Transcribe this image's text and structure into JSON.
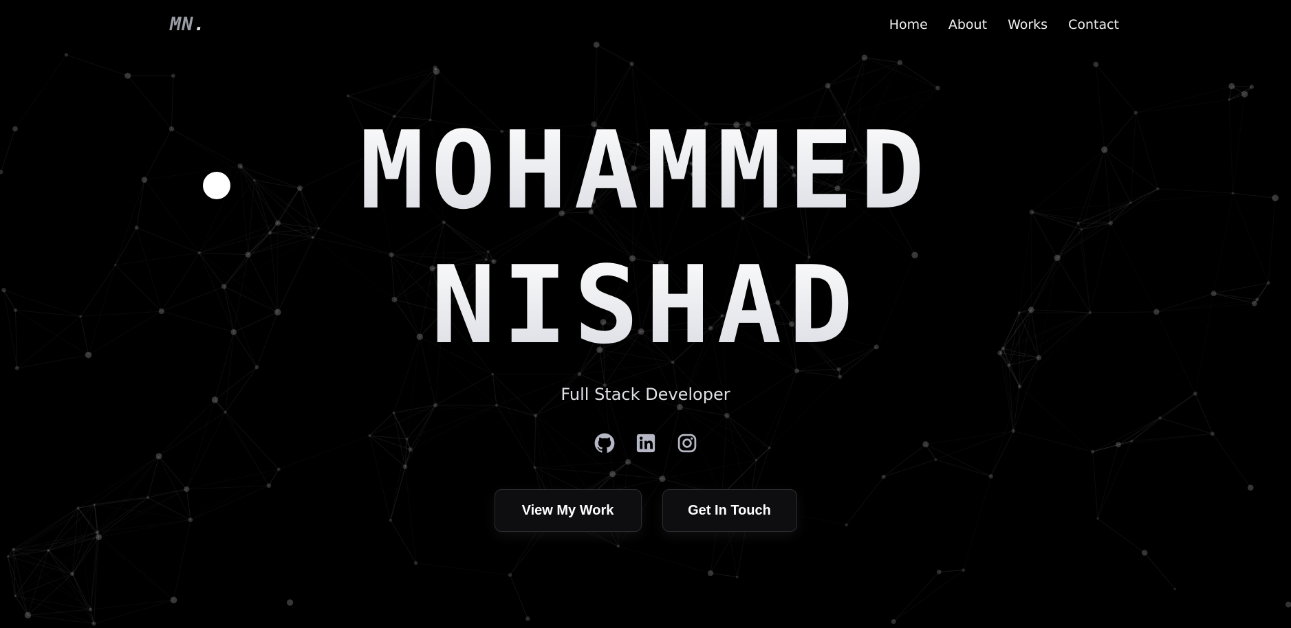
{
  "header": {
    "logo_main": "MN",
    "logo_dot": ".",
    "nav": [
      {
        "label": "Home"
      },
      {
        "label": "About"
      },
      {
        "label": "Works"
      },
      {
        "label": "Contact"
      }
    ]
  },
  "hero": {
    "name_line1": "MOHAMMED",
    "name_line2": "NISHAD",
    "subtitle": "Full Stack Developer",
    "socials": [
      {
        "icon": "github-icon"
      },
      {
        "icon": "linkedin-icon"
      },
      {
        "icon": "instagram-icon"
      }
    ],
    "buttons": {
      "primary": "View My Work",
      "secondary": "Get In Touch"
    }
  },
  "colors": {
    "background": "#000000",
    "text": "#ffffff",
    "icon": "#b5b8c4",
    "button_bg": "#0e0e10"
  }
}
